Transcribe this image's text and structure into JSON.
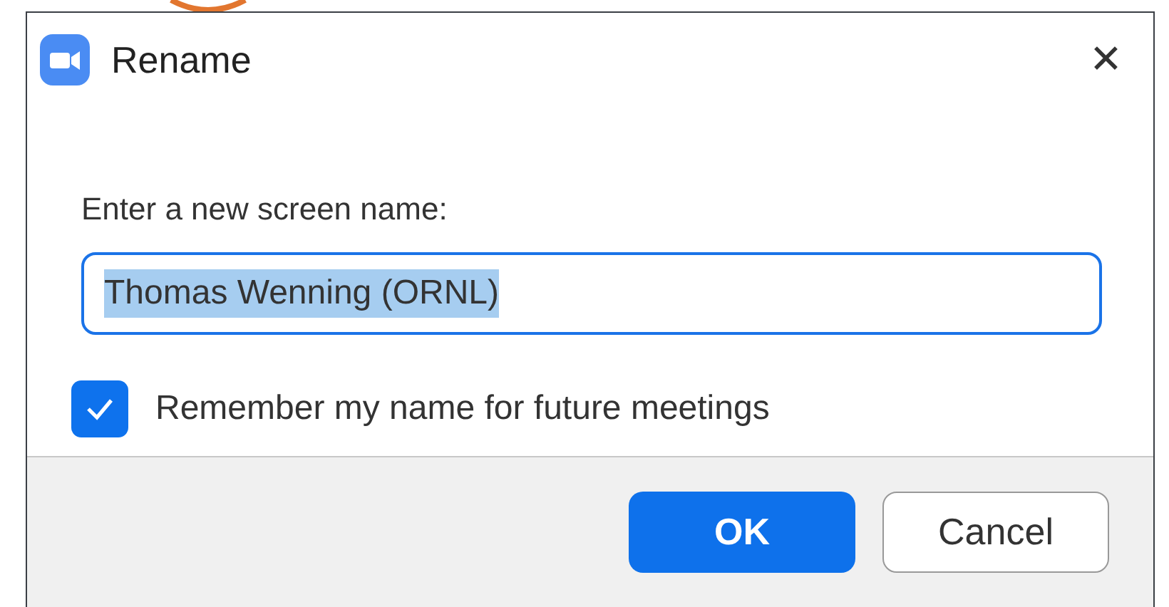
{
  "window": {
    "title": "Rename",
    "close": "✕"
  },
  "prompt": "Enter a new screen name:",
  "name_field": {
    "value": "Thomas Wenning (ORNL)",
    "text_selected": true,
    "focused": true
  },
  "remember": {
    "label": "Remember my name for future meetings",
    "checked": true
  },
  "buttons": [
    {
      "label": "OK",
      "kind": "primary"
    },
    {
      "label": "Cancel",
      "kind": "secondary"
    }
  ]
}
